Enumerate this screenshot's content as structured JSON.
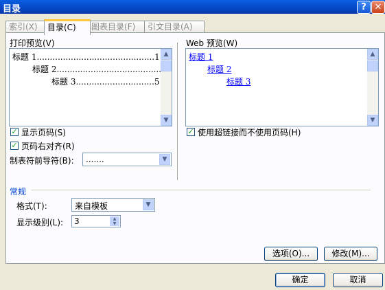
{
  "window": {
    "title": "目录",
    "help_glyph": "?",
    "close_glyph": "✕"
  },
  "tabs": [
    {
      "label": "索引(X)",
      "active": false
    },
    {
      "label": "目录(C)",
      "active": true
    },
    {
      "label": "图表目录(F)",
      "active": false
    },
    {
      "label": "引文目录(A)",
      "active": false
    }
  ],
  "print_preview": {
    "label": "打印预览(V)",
    "lines": [
      {
        "text": "标题 1.............................................1"
      },
      {
        "text": "标题 2........................................3"
      },
      {
        "text": "标题 3..............................5"
      }
    ]
  },
  "web_preview": {
    "label": "Web 预览(W)",
    "lines": [
      {
        "text": "标题 1"
      },
      {
        "text": "标题 2"
      },
      {
        "text": "标题 3"
      }
    ]
  },
  "options": {
    "show_page_numbers": {
      "label": "显示页码(S)",
      "checked": true
    },
    "right_align": {
      "label": "页码右对齐(R)",
      "checked": true
    },
    "use_hyperlinks": {
      "label": "使用超链接而不使用页码(H)",
      "checked": true
    },
    "tab_leader": {
      "label": "制表符前导符(B):",
      "value": "......."
    }
  },
  "general": {
    "heading": "常规",
    "format": {
      "label": "格式(T):",
      "value": "来自模板"
    },
    "levels": {
      "label": "显示级别(L):",
      "value": "3"
    }
  },
  "buttons": {
    "options": "选项(O)...",
    "modify": "修改(M)...",
    "ok": "确定",
    "cancel": "取消"
  },
  "colors": {
    "titlebar": "#0a5fe0",
    "link": "#0000ff",
    "tab_highlight": "#ffc83c"
  }
}
